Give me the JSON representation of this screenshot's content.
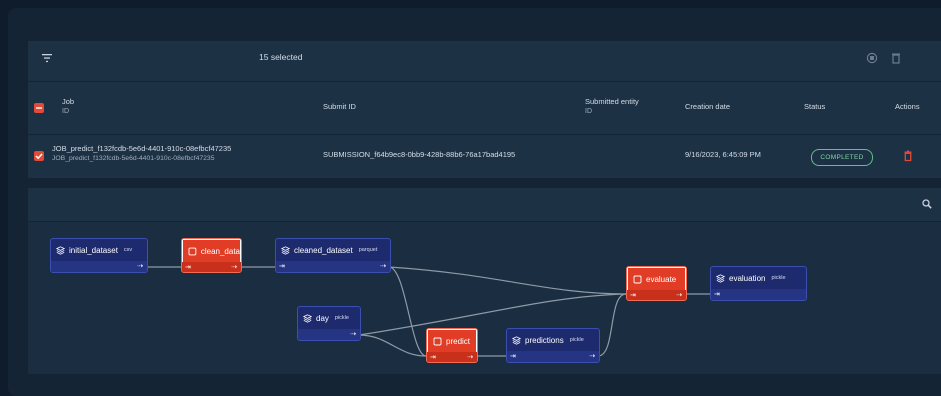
{
  "toolbar": {
    "selected_text": "15 selected"
  },
  "table": {
    "headers": {
      "job": "Job",
      "job_sub": "ID",
      "submit_id": "Submit ID",
      "submitted_entity": "Submitted entity",
      "submitted_entity_sub": "ID",
      "creation_date": "Creation date",
      "status": "Status",
      "actions": "Actions"
    },
    "rows": [
      {
        "job_id": "JOB_predict_f132fcdb-5e6d-4401-910c-08efbcf47235",
        "job_sub": "JOB_predict_f132fcdb-5e6d-4401-910c-08efbcf47235",
        "submit_id": "SUBMISSION_f64b9ec8-0bb9-428b-88b6-76a17bad4195",
        "creation_date": "9/16/2023, 6:45:09 PM",
        "status": "COMPLETED"
      }
    ]
  },
  "dag": {
    "nodes": [
      {
        "id": "initial_dataset",
        "label": "initial_dataset",
        "ext": "csv",
        "kind": "data"
      },
      {
        "id": "clean_data",
        "label": "clean_data",
        "ext": "",
        "kind": "task"
      },
      {
        "id": "cleaned_dataset",
        "label": "cleaned_dataset",
        "ext": "parquet",
        "kind": "data"
      },
      {
        "id": "day",
        "label": "day",
        "ext": "pickle",
        "kind": "data"
      },
      {
        "id": "predict",
        "label": "predict",
        "ext": "",
        "kind": "task"
      },
      {
        "id": "predictions",
        "label": "predictions",
        "ext": "pickle",
        "kind": "data"
      },
      {
        "id": "evaluate",
        "label": "evaluate",
        "ext": "",
        "kind": "task"
      },
      {
        "id": "evaluation",
        "label": "evaluation",
        "ext": "pickle",
        "kind": "data"
      }
    ]
  },
  "colors": {
    "task": "#e13c26",
    "data": "#1e2a6e",
    "completed": "#5fbf8a",
    "delete": "#e14a37"
  }
}
